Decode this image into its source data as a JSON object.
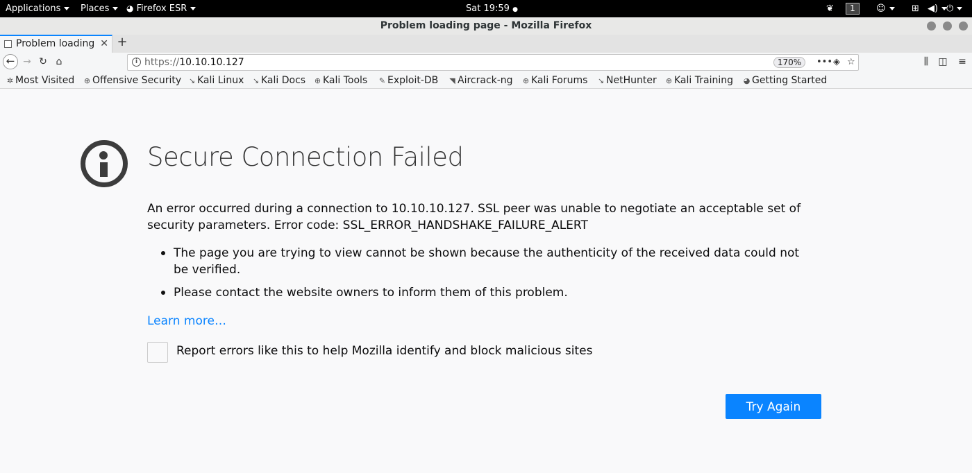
{
  "gnome_panel": {
    "applications": "Applications",
    "places": "Places",
    "app_name": "Firefox ESR",
    "clock": "Sat 19:59",
    "workspace": "1"
  },
  "window": {
    "title": "Problem loading page - Mozilla Firefox"
  },
  "tabs": [
    {
      "label": "Problem loading page",
      "active": true
    }
  ],
  "new_tab": "+",
  "navbar": {
    "url_scheme": "https://",
    "url_host": "10.10.10.127",
    "zoom": "170%",
    "more_actions": "•••"
  },
  "bookmarks": [
    {
      "label": "Most Visited",
      "icon": "gear-icon"
    },
    {
      "label": "Offensive Security",
      "icon": "globe-icon"
    },
    {
      "label": "Kali Linux",
      "icon": "kali-dragon-icon"
    },
    {
      "label": "Kali Docs",
      "icon": "kali-dragon-icon"
    },
    {
      "label": "Kali Tools",
      "icon": "globe-icon"
    },
    {
      "label": "Exploit-DB",
      "icon": "exploit-db-icon"
    },
    {
      "label": "Aircrack-ng",
      "icon": "aircrack-icon"
    },
    {
      "label": "Kali Forums",
      "icon": "globe-icon"
    },
    {
      "label": "NetHunter",
      "icon": "kali-dragon-icon"
    },
    {
      "label": "Kali Training",
      "icon": "globe-icon"
    },
    {
      "label": "Getting Started",
      "icon": "firefox-icon"
    }
  ],
  "error_page": {
    "title": "Secure Connection Failed",
    "description": "An error occurred during a connection to 10.10.10.127. SSL peer was unable to negotiate an acceptable set of security parameters. Error code: SSL_ERROR_HANDSHAKE_FAILURE_ALERT",
    "bullets": [
      "The page you are trying to view cannot be shown because the authenticity of the received data could not be verified.",
      "Please contact the website owners to inform them of this problem."
    ],
    "learn_more": "Learn more…",
    "report_label": "Report errors like this to help Mozilla identify and block malicious sites",
    "report_checked": false,
    "try_again": "Try Again"
  },
  "colors": {
    "accent": "#0a84ff",
    "page_background": "#f9f9fa",
    "gnome_panel": "#000000"
  }
}
